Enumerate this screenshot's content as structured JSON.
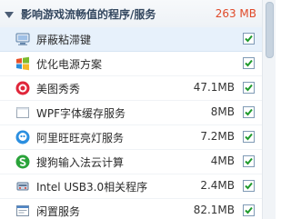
{
  "section": {
    "title": "影响游戏流畅值的程序/服务",
    "total_size": "263 MB",
    "collapse_icon": "chevron-down-icon"
  },
  "items": [
    {
      "name": "屏蔽粘滞键",
      "size": "",
      "checked": true,
      "icon": "monitor-icon"
    },
    {
      "name": "优化电源方案",
      "size": "",
      "checked": true,
      "icon": "windows-logo-icon"
    },
    {
      "name": "美图秀秀",
      "size": "47.1MB",
      "checked": true,
      "icon": "meitu-icon"
    },
    {
      "name": "WPF字体缓存服务",
      "size": "8MB",
      "checked": true,
      "icon": "blank-window-icon"
    },
    {
      "name": "阿里旺旺亮灯服务",
      "size": "7.2MB",
      "checked": true,
      "icon": "aliwangwang-icon"
    },
    {
      "name": "搜狗输入法云计算",
      "size": "4MB",
      "checked": true,
      "icon": "sogou-icon"
    },
    {
      "name": "Intel USB3.0相关程序",
      "size": "2.4MB",
      "checked": true,
      "icon": "usb-icon"
    },
    {
      "name": "闲置服务",
      "size": "82.1MB",
      "checked": true,
      "icon": "service-window-icon"
    }
  ],
  "colors": {
    "check_green": "#1f9a2c",
    "size_accent": "#e04a2a",
    "selected_row": "#e7f1fb"
  }
}
